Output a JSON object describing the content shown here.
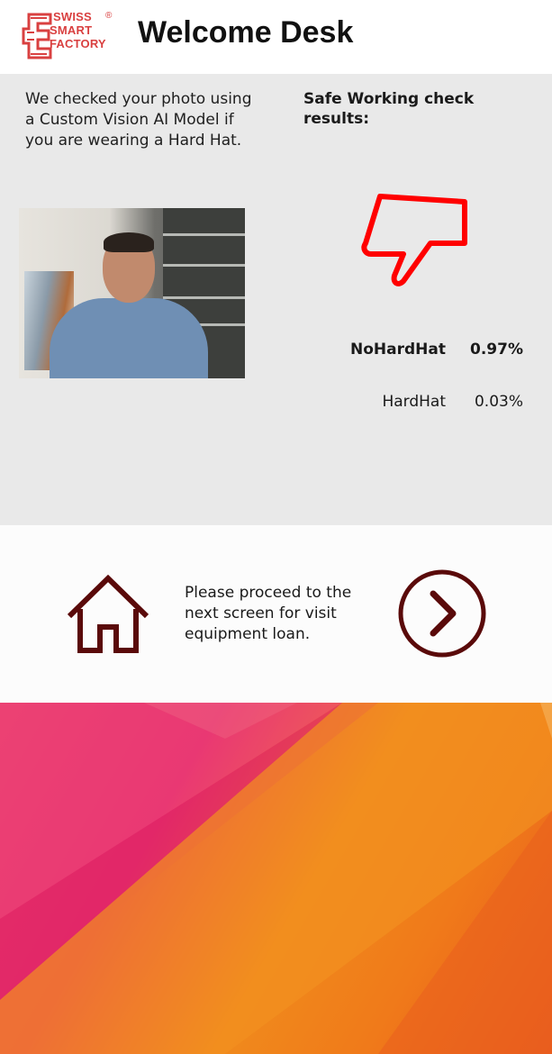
{
  "header": {
    "logo": {
      "line1": "SWISS",
      "line2": "SMART",
      "line3": "FACTORY",
      "reg": "®",
      "color": "#d94040"
    },
    "title": "Welcome Desk"
  },
  "result_panel": {
    "intro": "We checked your photo using a Custom Vision AI Model if you are wearing a Hard Hat.",
    "heading": "Safe Working check results:",
    "verdict_icon": "thumbs-down-icon",
    "verdict_color": "#ff0000",
    "results": [
      {
        "tag": "NoHardHat",
        "probability": "0.97%"
      },
      {
        "tag": "HardHat",
        "probability": "0.03%"
      }
    ]
  },
  "proceed": {
    "home_icon": "home-icon",
    "text": "Please proceed to the next screen for visit equipment loan.",
    "next_icon": "chevron-right-circle-icon",
    "icon_color": "#5a0a0a"
  },
  "colors": {
    "panel_bg": "#e9e9e9",
    "wallpaper_pink": "#e3236a",
    "wallpaper_orange": "#f08a1c"
  }
}
